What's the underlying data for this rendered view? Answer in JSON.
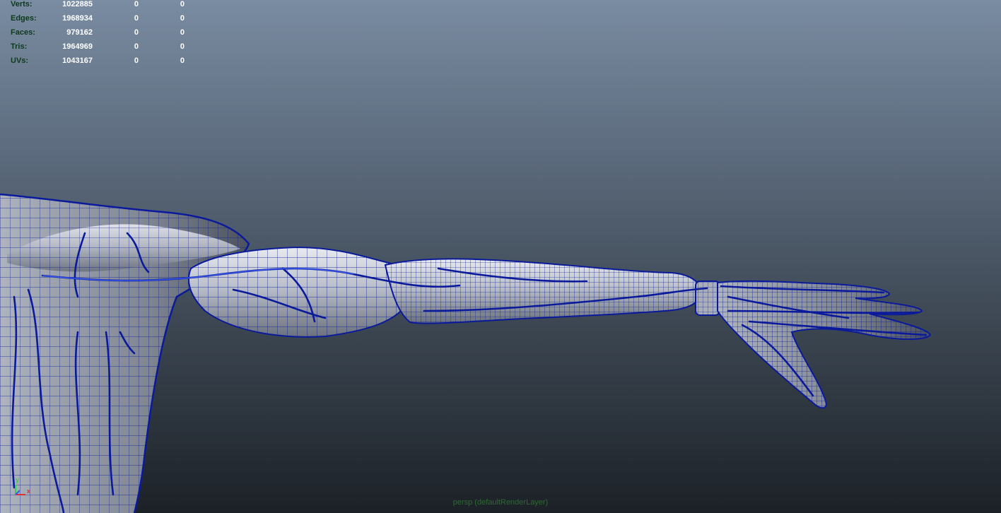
{
  "hud": {
    "rows": [
      {
        "label": "Verts:",
        "values": [
          "1022885",
          "0",
          "0"
        ]
      },
      {
        "label": "Edges:",
        "values": [
          "1968934",
          "0",
          "0"
        ]
      },
      {
        "label": "Faces:",
        "values": [
          "979162",
          "0",
          "0"
        ]
      },
      {
        "label": "Tris:",
        "values": [
          "1964969",
          "0",
          "0"
        ]
      },
      {
        "label": "UVs:",
        "values": [
          "1043167",
          "0",
          "0"
        ]
      }
    ]
  },
  "axis": {
    "y_label": "y",
    "x_label": "x",
    "y_color": "#2fd14a",
    "x_color": "#e03030"
  },
  "camera": {
    "label": "persp (defaultRenderLayer)"
  },
  "colors": {
    "background_top": "#7a8ca2",
    "background_bottom": "#1c2127",
    "wireframe": "#0a1a9a",
    "surface": "#c8ccd4"
  }
}
